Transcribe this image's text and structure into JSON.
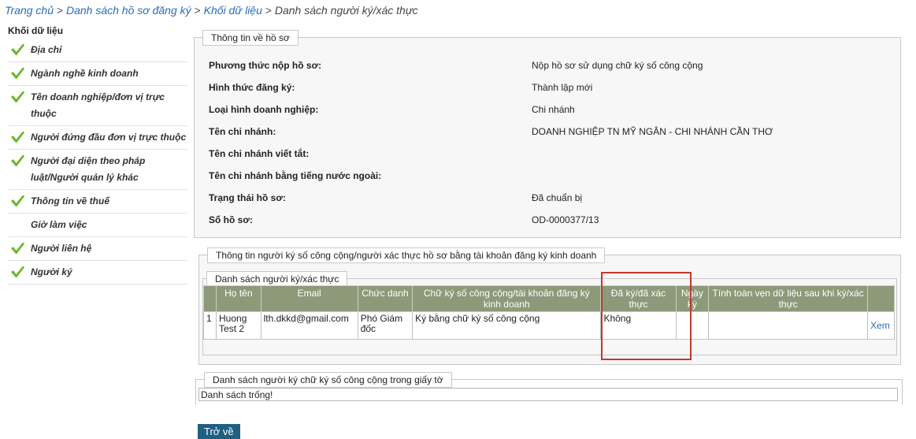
{
  "breadcrumb": {
    "items": [
      "Trang chủ",
      "Danh sách hồ sơ đăng ký",
      "Khối dữ liệu"
    ],
    "current": "Danh sách người ký/xác thực",
    "separator": ">"
  },
  "sidebar": {
    "title": "Khối dữ liệu",
    "items": [
      {
        "label": "Địa chỉ",
        "checked": true
      },
      {
        "label": "Ngành nghề kinh doanh",
        "checked": true
      },
      {
        "label": "Tên doanh nghiệp/đơn vị trực thuộc",
        "checked": true
      },
      {
        "label": "Người đứng đầu đơn vị trực thuộc",
        "checked": true
      },
      {
        "label": "Người đại diện theo pháp luật/Người quản lý khác",
        "checked": true
      },
      {
        "label": "Thông tin về thuế",
        "checked": true
      },
      {
        "label": "Giờ làm việc",
        "checked": false
      },
      {
        "label": "Người liên hệ",
        "checked": true
      },
      {
        "label": "Người ký",
        "checked": true
      }
    ],
    "check_color": "#6fb52c"
  },
  "profile": {
    "legend": "Thông tin về hồ sơ",
    "rows": [
      {
        "label": "Phương thức nộp hồ sơ:",
        "value": "Nộp hồ sơ sử dụng chữ ký số công cộng"
      },
      {
        "label": "Hình thức đăng ký:",
        "value": "Thành lập mới"
      },
      {
        "label": "Loại hình doanh nghiệp:",
        "value": "Chi nhánh"
      },
      {
        "label": "Tên chi nhánh:",
        "value": "DOANH NGHIỆP TN MỸ NGÂN - CHI NHÁNH CẦN THƠ"
      },
      {
        "label": "Tên chi nhánh viết tắt:",
        "value": ""
      },
      {
        "label": "Tên chi nhánh bằng tiếng nước ngoài:",
        "value": ""
      },
      {
        "label": "Trạng thái hồ sơ:",
        "value": "Đã chuẩn bị"
      },
      {
        "label": "Số hồ sơ:",
        "value": "OD-0000377/13"
      }
    ]
  },
  "signer_info": {
    "legend": "Thông tin người ký số công cộng/người xác thực hồ sơ bằng tài khoản đăng ký kinh doanh",
    "sub_legend": "Danh sách người ký/xác thực",
    "headers": [
      "",
      "Họ tên",
      "Email",
      "Chức danh",
      "Chữ ký số công cộng/tài khoản đăng ký kinh doanh",
      "Đã ký/đã xác thực",
      "Ngày ký",
      "Tính toàn vẹn dữ liệu sau khi ký/xác thực",
      ""
    ],
    "rows": [
      {
        "no": "1",
        "name": "Huong Test 2",
        "email": "lth.dkkd@gmail.com",
        "title": "Phó Giám đốc",
        "signature": "Ký bằng chữ ký số công cộng",
        "signed": "Không",
        "date": "",
        "integrity": "",
        "action": "Xem"
      }
    ],
    "header_color": "#8c9a7a"
  },
  "doc_signers": {
    "legend": "Danh sách người ký chữ ký số công cộng trong giấy tờ",
    "empty_text": "Danh sách trống!"
  },
  "back_button": "Trở về"
}
